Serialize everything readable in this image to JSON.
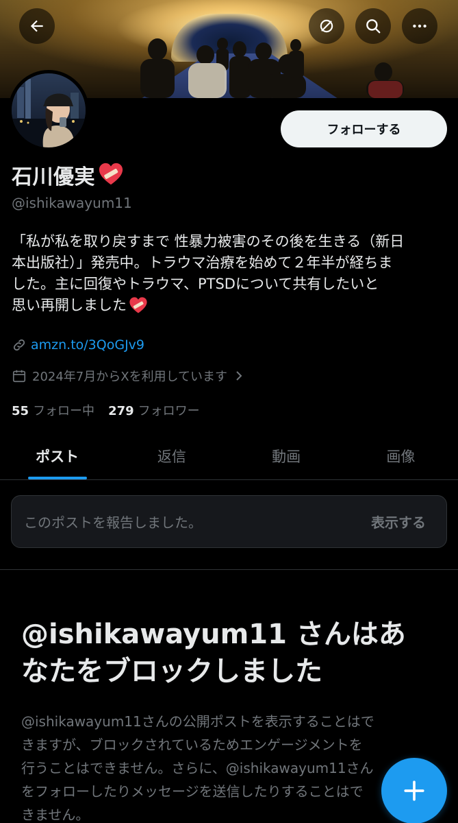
{
  "header": {
    "back_icon": "arrow-left-icon",
    "refresh_icon": "refresh-icon",
    "search_icon": "search-icon",
    "more_icon": "more-horizontal-icon"
  },
  "profile": {
    "follow_label": "フォローする",
    "name": "石川優実",
    "handle": "@ishikawayum11",
    "bio_lines": [
      "「私が私を取り戻すまで 性暴力被害のその後を生きる（新日",
      "本出版社）」発売中。トラウマ治療を始めて２年半が経ちま",
      "した。主に回復やトラウマ、PTSDについて共有したいと",
      "思い再開しました"
    ],
    "link": "amzn.to/3QoGJv9",
    "joined": "2024年7月からXを利用しています",
    "following_count": "55",
    "following_label": "フォロー中",
    "followers_count": "279",
    "followers_label": "フォロワー"
  },
  "tabs": [
    {
      "label": "ポスト"
    },
    {
      "label": "返信"
    },
    {
      "label": "動画"
    },
    {
      "label": "画像"
    }
  ],
  "report": {
    "message": "このポストを報告しました。",
    "show_label": "表示する"
  },
  "blocked": {
    "title_lines": [
      "@ishikawayum11 さんはあ",
      "なたをブロックしました"
    ],
    "description_lines": [
      "@ishikawayum11さんの公開ポストを表示することはで",
      "きますが、ブロックされているためエンゲージメントを",
      "行うことはできません。さらに、@ishikawayum11さん",
      "をフォローしたりメッセージを送信したりすることはで",
      "きません。"
    ]
  },
  "fab": {
    "icon": "plus-icon"
  },
  "colors": {
    "accent": "#1d9bf0",
    "background": "#000000",
    "text": "#e7e9ea",
    "muted": "#71767b"
  }
}
